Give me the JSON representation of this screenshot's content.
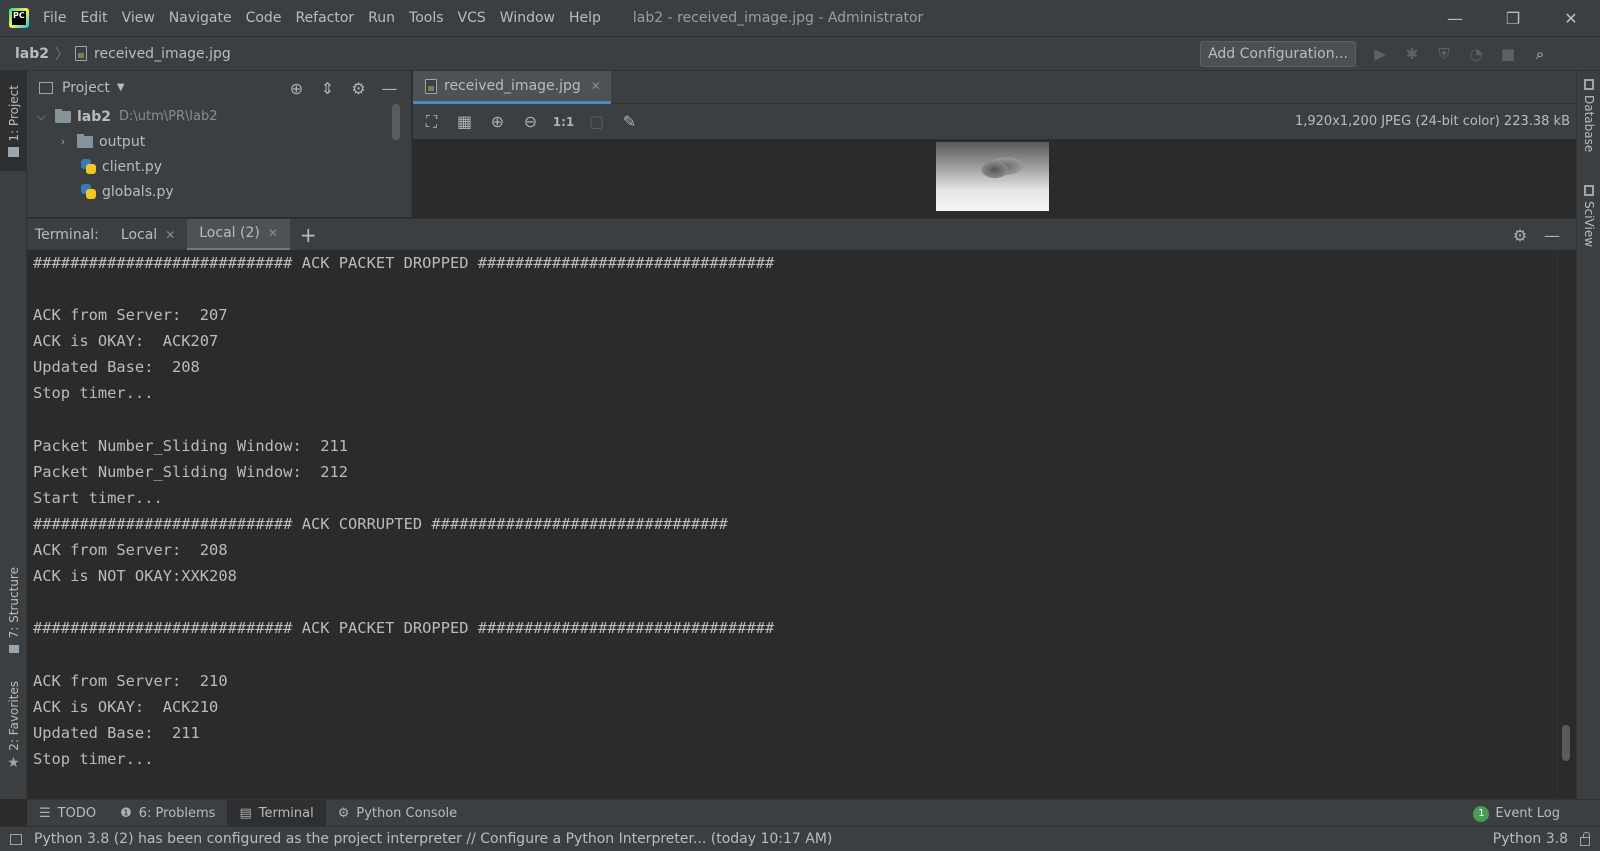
{
  "menu": {
    "logo_text": "PC",
    "items": [
      "File",
      "Edit",
      "View",
      "Navigate",
      "Code",
      "Refactor",
      "Run",
      "Tools",
      "VCS",
      "Window",
      "Help"
    ],
    "window_title": "lab2 - received_image.jpg - Administrator"
  },
  "window_controls": {
    "minimize": "—",
    "restore": "❐",
    "close": "✕"
  },
  "navbar": {
    "project": "lab2",
    "separator": "〉",
    "file": "received_image.jpg",
    "add_config": "Add Configuration...",
    "actions": {
      "run": "▶",
      "debug": "✱",
      "coverage": "⛨",
      "profile": "◔",
      "stop": "■",
      "search": "⌕"
    }
  },
  "left_strip": {
    "project_tab": "1: Project",
    "structure_tab": "7: Structure",
    "favorites_tab": "2: Favorites",
    "favorites_star": "★"
  },
  "right_strip": {
    "database_tab": "Database",
    "sciview_tab": "SciView"
  },
  "project_panel": {
    "title": "Project",
    "caret": "▼",
    "tools": {
      "locate": "⊕",
      "collapse": "⇕",
      "settings": "⚙",
      "hide": "—"
    },
    "tree": {
      "root": {
        "arrow": "⌵",
        "name": "lab2",
        "path": "D:\\utm\\PR\\lab2"
      },
      "output": {
        "arrow": "›",
        "name": "output"
      },
      "files": [
        "client.py",
        "globals.py"
      ]
    }
  },
  "editor": {
    "tab": "received_image.jpg",
    "tab_close": "✕",
    "toolbar": {
      "fit": "⛶",
      "grid": "▦",
      "zoom_in": "⊕",
      "zoom_out": "⊖",
      "actual": "1:1",
      "background": "▢",
      "color_picker": "✎"
    },
    "image_info": "1,920x1,200 JPEG (24-bit color) 223.38 kB"
  },
  "terminal": {
    "label": "Terminal:",
    "tabs": [
      "Local",
      "Local (2)"
    ],
    "tab_close": "✕",
    "add": "+",
    "tools": {
      "settings": "⚙",
      "hide": "—"
    },
    "lines": [
      "############################ ACK PACKET DROPPED ################################",
      "",
      "ACK from Server:  207",
      "ACK is OKAY:  ACK207",
      "Updated Base:  208",
      "Stop timer...",
      "",
      "Packet Number_Sliding Window:  211",
      "Packet Number_Sliding Window:  212",
      "Start timer...",
      "############################ ACK CORRUPTED ################################",
      "ACK from Server:  208",
      "ACK is NOT OKAY:XXK208",
      "",
      "############################ ACK PACKET DROPPED ################################",
      "",
      "ACK from Server:  210",
      "ACK is OKAY:  ACK210",
      "Updated Base:  211",
      "Stop timer..."
    ]
  },
  "bottom_tabs": {
    "todo": {
      "icon": "☰",
      "label": "TODO"
    },
    "problems": {
      "icon": "❶",
      "label": "6: Problems"
    },
    "terminal": {
      "icon": "▤",
      "label": "Terminal"
    },
    "python_console": {
      "icon": "⚙",
      "label": "Python Console"
    },
    "event_log": {
      "count": "1",
      "label": "Event Log"
    }
  },
  "status_bar": {
    "message": "Python 3.8 (2) has been configured as the project interpreter // Configure a Python Interpreter... (today 10:17 AM)",
    "interpreter": "Python 3.8"
  }
}
